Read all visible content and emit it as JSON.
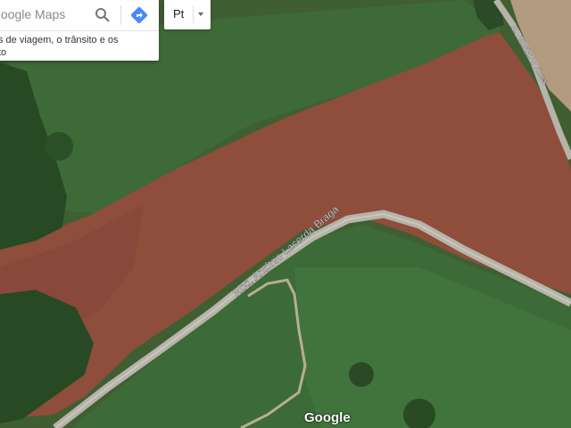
{
  "search": {
    "placeholder": "Google Maps",
    "info_line1": "s de viagem, o trânsito e os",
    "info_line2": "to",
    "search_icon": "search-icon",
    "directions_icon": "directions-icon"
  },
  "language": {
    "selected": "Pt",
    "icon": "caret-down-icon"
  },
  "map": {
    "road_main": "Rod. Antônio Lacerda Braga",
    "road_side": "R. Gustavo Kuss",
    "attribution": "Google",
    "colors": {
      "field_green": "#3e6a38",
      "plowed_soil": "#8f4d3c",
      "forest": "#274a24",
      "road": "#b6b3a9"
    }
  }
}
